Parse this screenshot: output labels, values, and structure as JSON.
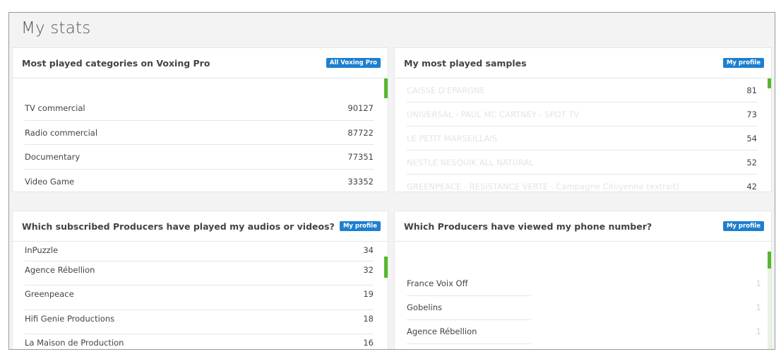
{
  "page": {
    "title": "My stats"
  },
  "panels": {
    "categories": {
      "title": "Most played categories on Voxing Pro",
      "badge": "All Voxing Pro",
      "rows": [
        {
          "name": "TV commercial",
          "value": "90127"
        },
        {
          "name": "Radio commercial",
          "value": "87722"
        },
        {
          "name": "Documentary",
          "value": "77351"
        },
        {
          "name": "Video Game",
          "value": "33352"
        }
      ]
    },
    "samples": {
      "title": "My most played samples",
      "badge": "My profile",
      "rows": [
        {
          "name": "CAISSE D'EPARGNE",
          "value": "81"
        },
        {
          "name": "UNIVERSAL - PAUL MC CARTNEY - SPOT TV",
          "value": "73"
        },
        {
          "name": "LE PETIT MARSEILLAIS",
          "value": "54"
        },
        {
          "name": "NESTLE NESQUIK ALL NATURAL",
          "value": "52"
        },
        {
          "name": "GREENPEACE - RESISTANCE VERTE - Campagne Citoyenne (extrait)",
          "value": "42"
        }
      ]
    },
    "producers_played": {
      "title": "Which subscribed Producers have played my audios or videos?",
      "badge": "My profile",
      "rows": [
        {
          "name": "InPuzzle",
          "value": "34"
        },
        {
          "name": "Agence Rébellion",
          "value": "32"
        },
        {
          "name": "Greenpeace",
          "value": "19"
        },
        {
          "name": "Hifi Genie Productions",
          "value": "18"
        },
        {
          "name": "La Maison de Production",
          "value": "16"
        }
      ]
    },
    "producers_phone": {
      "title": "Which Producers have viewed my phone number?",
      "badge": "My profile",
      "rows": [
        {
          "name": "France Voix Off",
          "value": "1"
        },
        {
          "name": "Gobelins",
          "value": "1"
        },
        {
          "name": "Agence Rébellion",
          "value": "1"
        }
      ]
    }
  }
}
